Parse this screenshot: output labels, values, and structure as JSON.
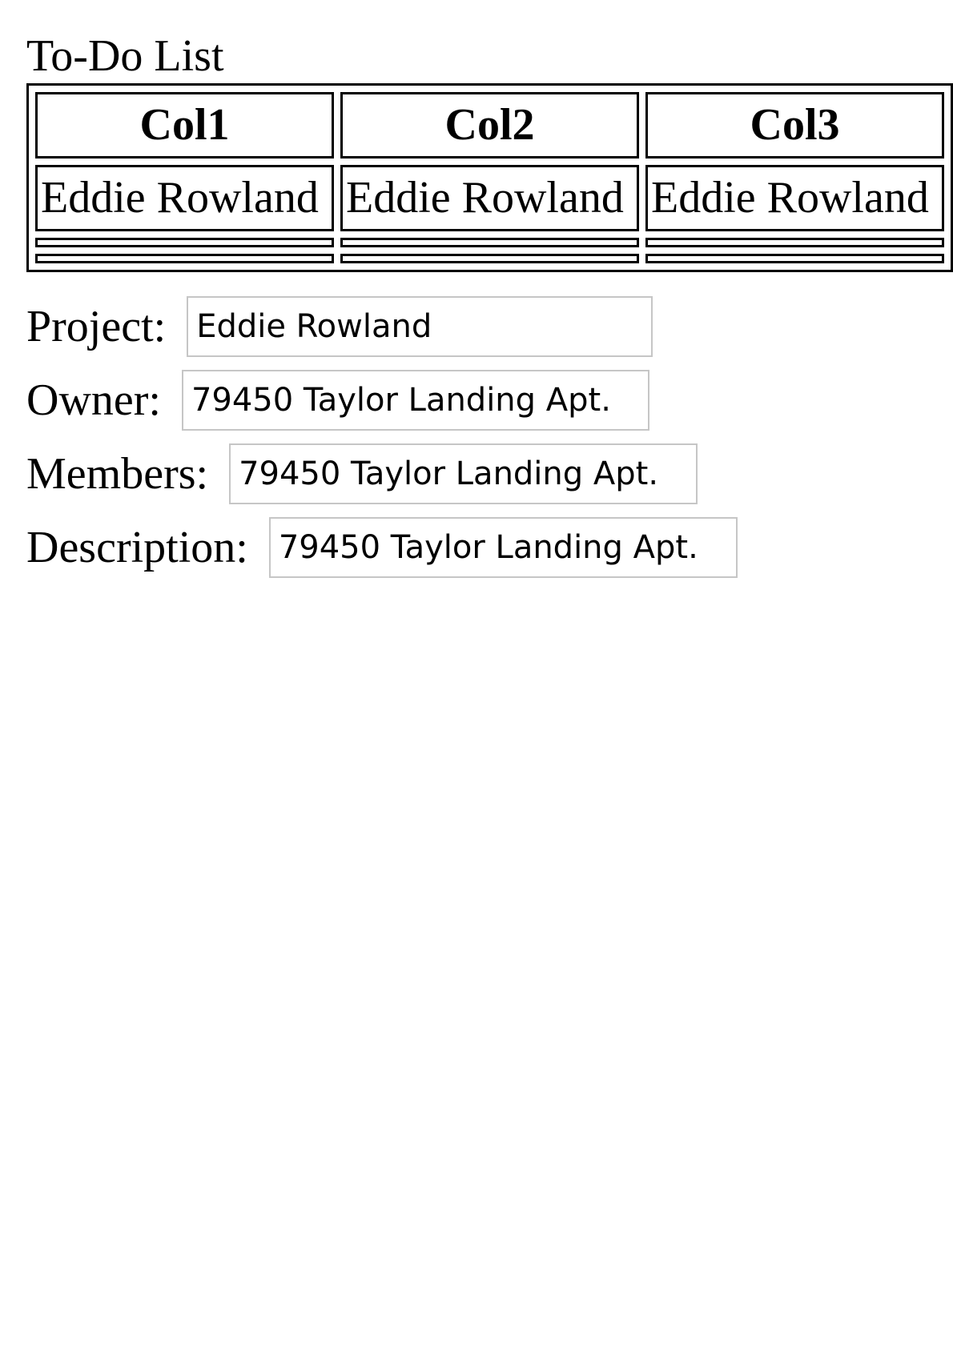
{
  "page": {
    "title": "To-Do List"
  },
  "table": {
    "headers": [
      "Col1",
      "Col2",
      "Col3"
    ],
    "rows": [
      [
        "Eddie Rowland",
        "Eddie Rowland",
        "Eddie Rowland"
      ]
    ]
  },
  "form": {
    "project": {
      "label": "Project:",
      "value": "Eddie Rowland"
    },
    "owner": {
      "label": "Owner:",
      "value": "79450 Taylor Landing Apt."
    },
    "members": {
      "label": "Members:",
      "value": "79450 Taylor Landing Apt."
    },
    "description": {
      "label": "Description:",
      "value": "79450 Taylor Landing Apt."
    }
  }
}
